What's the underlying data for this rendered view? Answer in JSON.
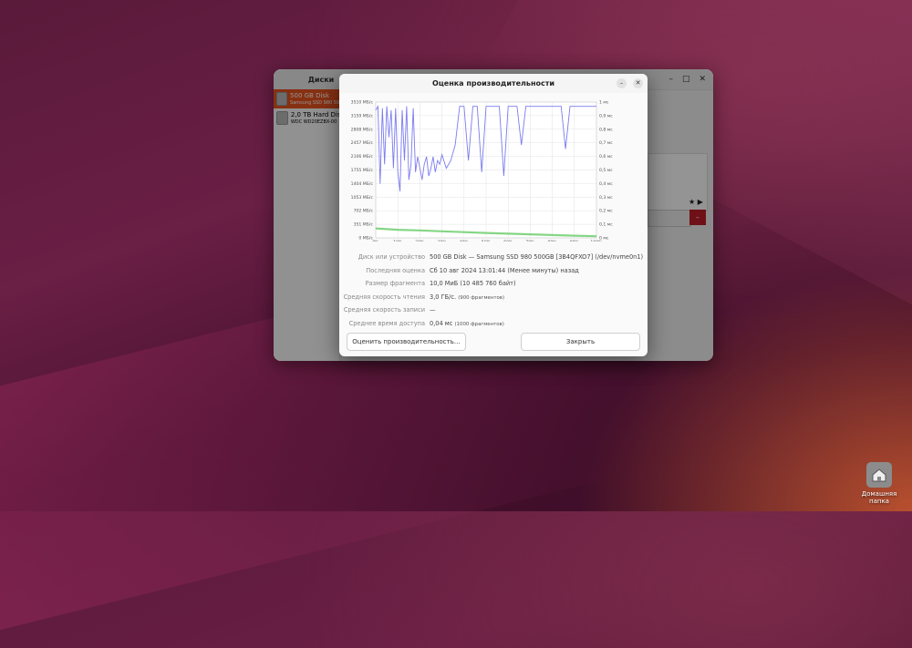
{
  "main_window": {
    "sidebar_title": "Диски",
    "title": "500 GB Disk",
    "disks": [
      {
        "name": "500 GB Disk",
        "model": "Samsung SSD 980 500GB",
        "selected": true
      },
      {
        "name": "2,0 TB Hard Disk",
        "model": "WDC WD20EZBX-00",
        "selected": false
      }
    ]
  },
  "dialog": {
    "title": "Оценка производительности",
    "fields": [
      {
        "label": "Диск или устройство",
        "value": "500 GB Disk — Samsung SSD 980 500GB [3B4QFXO7] (/dev/nvme0n1)",
        "note": ""
      },
      {
        "label": "Последняя оценка",
        "value": "Сб 10 авг 2024 13:01:44 (Менее минуты) назад",
        "note": ""
      },
      {
        "label": "Размер фрагмента",
        "value": "10,0 МиБ (10 485 760 байт)",
        "note": ""
      },
      {
        "label": "Средняя скорость чтения",
        "value": "3,0 ГБ/с.",
        "note": "(900 фрагментов)"
      },
      {
        "label": "Средняя скорость записи",
        "value": "—",
        "note": ""
      },
      {
        "label": "Среднее время доступа",
        "value": "0,04 мс",
        "note": "(1000 фрагментов)"
      }
    ],
    "btn_benchmark": "Оценить производительность…",
    "btn_close": "Закрыть"
  },
  "chart_data": {
    "type": "line",
    "left_axis_ticks": [
      "0 МБ/с",
      "351 МБ/с",
      "702 МБ/с",
      "1053 МБ/с",
      "1404 МБ/с",
      "1755 МБ/с",
      "2106 МБ/с",
      "2457 МБ/с",
      "2808 МБ/с",
      "3159 МБ/с",
      "3510 МБ/с"
    ],
    "right_axis_ticks": [
      "0 мс",
      "0,1 мс",
      "0,2 мс",
      "0,3 мс",
      "0,4 мс",
      "0,5 мс",
      "0,6 мс",
      "0,7 мс",
      "0,8 мс",
      "0,9 мс",
      "1 мс"
    ],
    "x_ticks": [
      "0%",
      "10%",
      "20%",
      "30%",
      "40%",
      "50%",
      "60%",
      "70%",
      "80%",
      "90%",
      "100%"
    ],
    "ylim_left": [
      0,
      3510
    ],
    "ylim_right": [
      0,
      1
    ],
    "xlim": [
      0,
      100
    ],
    "grid": true,
    "series": [
      {
        "color": "#7b7bf0",
        "x": [
          0,
          1,
          2,
          3,
          4,
          5,
          6,
          7,
          8,
          9,
          10,
          11,
          12,
          13,
          14,
          15,
          16,
          17,
          18,
          19,
          20,
          21,
          22,
          23,
          24,
          25,
          26,
          27,
          28,
          29,
          30,
          32,
          34,
          36,
          38,
          40,
          42,
          44,
          46,
          48,
          50,
          52,
          54,
          56,
          58,
          60,
          62,
          64,
          66,
          68,
          70,
          72,
          74,
          76,
          78,
          80,
          82,
          84,
          86,
          88,
          90,
          92,
          94,
          96,
          98,
          100
        ],
        "values": [
          3300,
          3400,
          1400,
          3350,
          1900,
          3400,
          2600,
          3300,
          1800,
          3350,
          1700,
          1200,
          3300,
          2000,
          3400,
          1500,
          1900,
          3350,
          1700,
          2100,
          1800,
          1500,
          1900,
          2100,
          1600,
          1800,
          2100,
          1700,
          2000,
          1900,
          2150,
          1800,
          2000,
          2400,
          3400,
          3400,
          2000,
          3400,
          3400,
          1700,
          3400,
          3400,
          3400,
          3400,
          1600,
          3400,
          3400,
          3400,
          2400,
          3400,
          3400,
          3400,
          3400,
          3400,
          3400,
          3400,
          3400,
          3400,
          2300,
          3400,
          3400,
          3400,
          3400,
          3400,
          3400,
          3400
        ]
      },
      {
        "color": "#5cc85c",
        "x": [
          0,
          10,
          20,
          30,
          40,
          50,
          60,
          70,
          80,
          90,
          100
        ],
        "values": [
          0.07,
          0.06,
          0.055,
          0.048,
          0.042,
          0.036,
          0.031,
          0.026,
          0.021,
          0.016,
          0.012
        ]
      }
    ]
  },
  "desktop": {
    "home_folder_label": "Домашняя папка"
  }
}
